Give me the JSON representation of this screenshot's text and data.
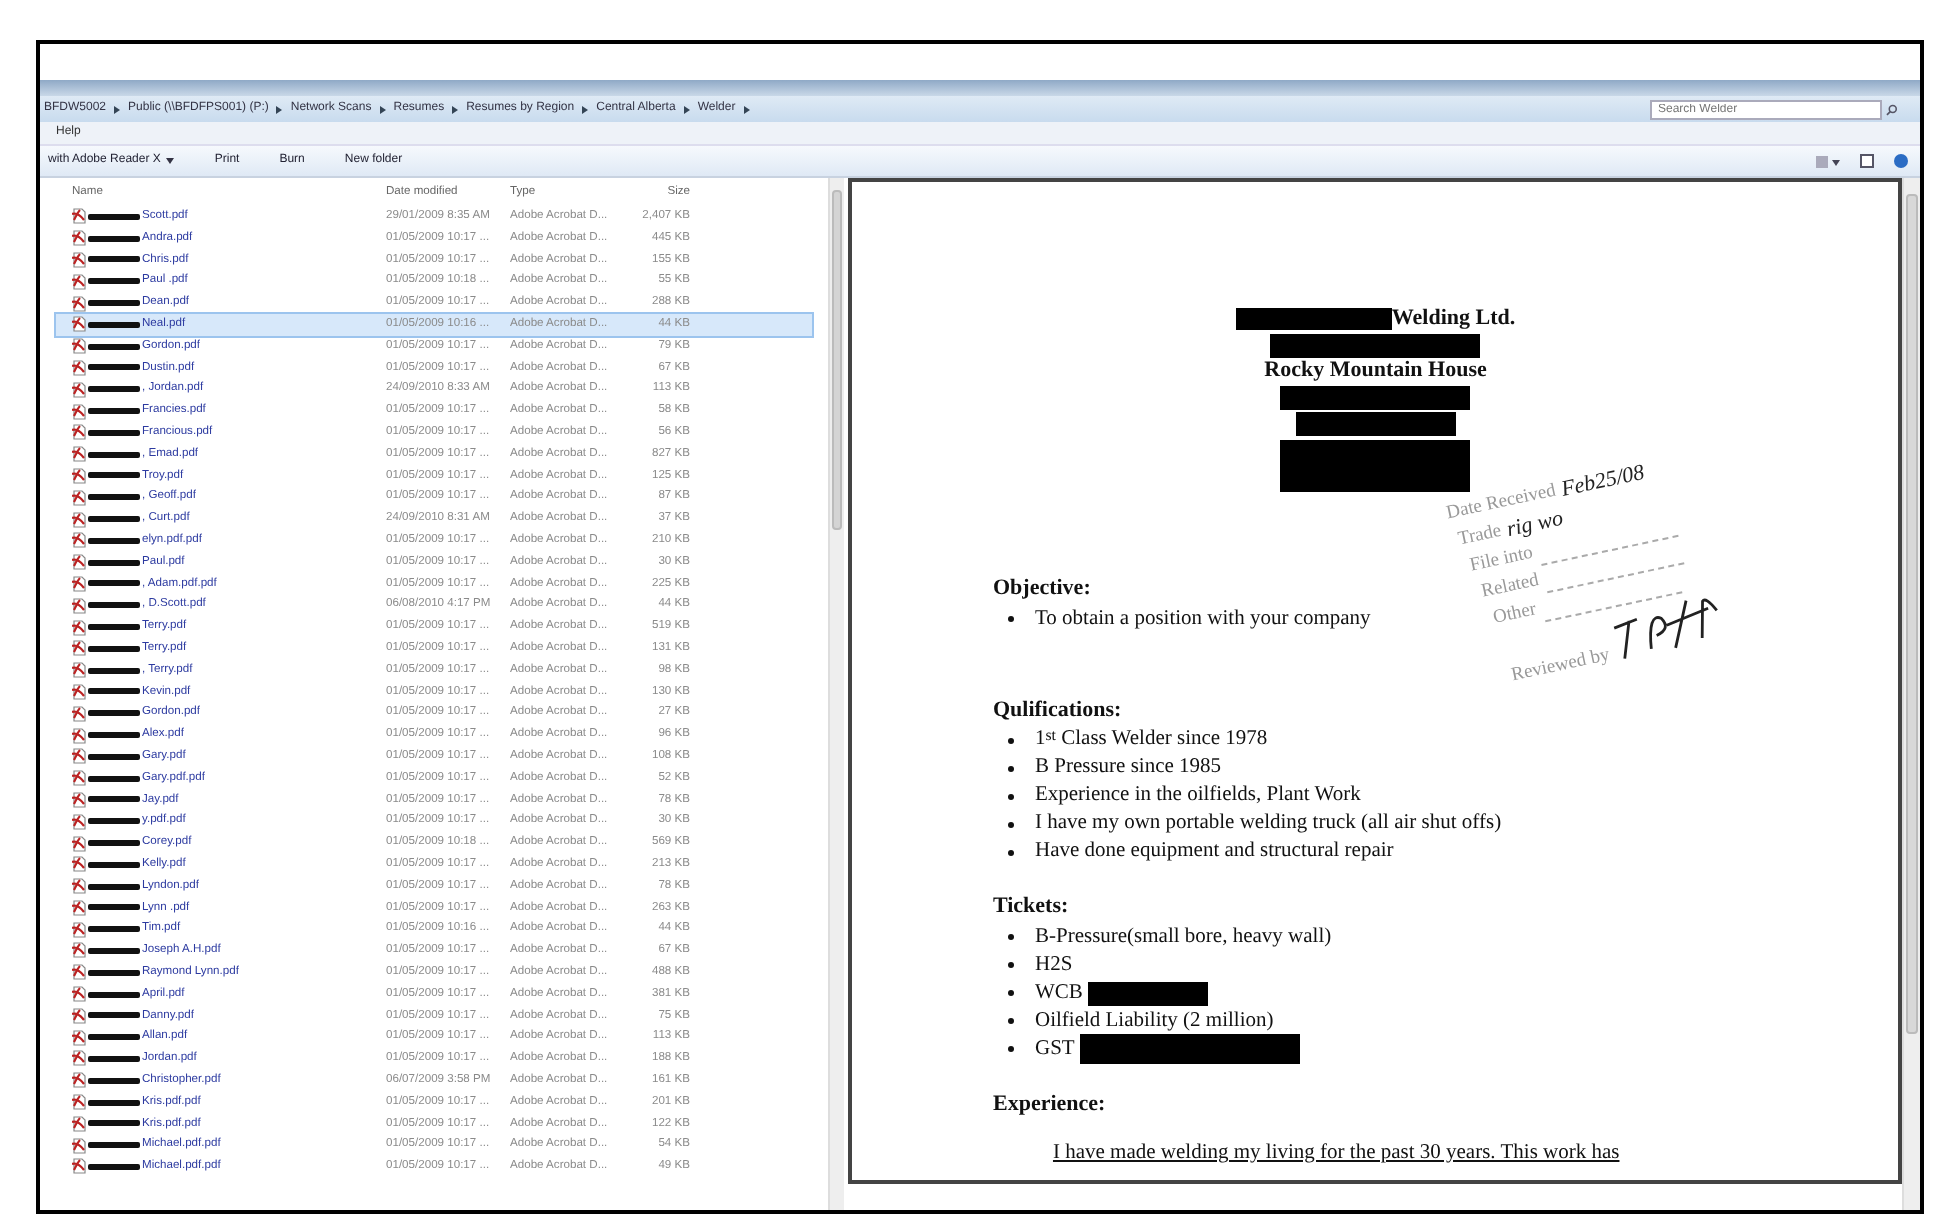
{
  "address": {
    "crumbs": [
      "BFDW5002",
      "Public (\\\\BFDFPS001) (P:)",
      "Network Scans",
      "Resumes",
      "Resumes by Region",
      "Central Alberta",
      "Welder"
    ]
  },
  "search": {
    "placeholder": "Search Welder"
  },
  "menu": [
    "Help"
  ],
  "toolbar": [
    {
      "label": "with Adobe Reader X",
      "dropdown": true
    },
    {
      "label": "Print",
      "dropdown": false
    },
    {
      "label": "Burn",
      "dropdown": false
    },
    {
      "label": "New folder",
      "dropdown": false
    }
  ],
  "columns": [
    "Name",
    "Date modified",
    "Type",
    "Size"
  ],
  "files": [
    {
      "name": "Scott.pdf",
      "date": "29/01/2009 8:35 AM",
      "type": "Adobe Acrobat D...",
      "size": "2,407 KB",
      "redacted": true,
      "selected": false
    },
    {
      "name": "Andra.pdf",
      "date": "01/05/2009 10:17 ...",
      "type": "Adobe Acrobat D...",
      "size": "445 KB",
      "redacted": true,
      "selected": false
    },
    {
      "name": "Chris.pdf",
      "date": "01/05/2009 10:17 ...",
      "type": "Adobe Acrobat D...",
      "size": "155 KB",
      "redacted": true,
      "selected": false
    },
    {
      "name": "Paul .pdf",
      "date": "01/05/2009 10:18 ...",
      "type": "Adobe Acrobat D...",
      "size": "55 KB",
      "redacted": true,
      "selected": false
    },
    {
      "name": "Dean.pdf",
      "date": "01/05/2009 10:17 ...",
      "type": "Adobe Acrobat D...",
      "size": "288 KB",
      "redacted": true,
      "selected": false
    },
    {
      "name": "Neal.pdf",
      "date": "01/05/2009 10:16 ...",
      "type": "Adobe Acrobat D...",
      "size": "44 KB",
      "redacted": true,
      "selected": true
    },
    {
      "name": "Gordon.pdf",
      "date": "01/05/2009 10:17 ...",
      "type": "Adobe Acrobat D...",
      "size": "79 KB",
      "redacted": true,
      "selected": false
    },
    {
      "name": "Dustin.pdf",
      "date": "01/05/2009 10:17 ...",
      "type": "Adobe Acrobat D...",
      "size": "67 KB",
      "redacted": true,
      "selected": false
    },
    {
      "name": ", Jordan.pdf",
      "date": "24/09/2010 8:33 AM",
      "type": "Adobe Acrobat D...",
      "size": "113 KB",
      "redacted": true,
      "selected": false
    },
    {
      "name": "Francies.pdf",
      "date": "01/05/2009 10:17 ...",
      "type": "Adobe Acrobat D...",
      "size": "58 KB",
      "redacted": true,
      "selected": false
    },
    {
      "name": "Francious.pdf",
      "date": "01/05/2009 10:17 ...",
      "type": "Adobe Acrobat D...",
      "size": "56 KB",
      "redacted": true,
      "selected": false
    },
    {
      "name": ", Emad.pdf",
      "date": "01/05/2009 10:17 ...",
      "type": "Adobe Acrobat D...",
      "size": "827 KB",
      "redacted": true,
      "selected": false
    },
    {
      "name": "Troy.pdf",
      "date": "01/05/2009 10:17 ...",
      "type": "Adobe Acrobat D...",
      "size": "125 KB",
      "redacted": true,
      "selected": false
    },
    {
      "name": ", Geoff.pdf",
      "date": "01/05/2009 10:17 ...",
      "type": "Adobe Acrobat D...",
      "size": "87 KB",
      "redacted": true,
      "selected": false
    },
    {
      "name": ", Curt.pdf",
      "date": "24/09/2010 8:31 AM",
      "type": "Adobe Acrobat D...",
      "size": "37 KB",
      "redacted": true,
      "selected": false
    },
    {
      "name": "elyn.pdf.pdf",
      "date": "01/05/2009 10:17 ...",
      "type": "Adobe Acrobat D...",
      "size": "210 KB",
      "redacted": true,
      "selected": false
    },
    {
      "name": "Paul.pdf",
      "date": "01/05/2009 10:17 ...",
      "type": "Adobe Acrobat D...",
      "size": "30 KB",
      "redacted": true,
      "selected": false
    },
    {
      "name": ", Adam.pdf.pdf",
      "date": "01/05/2009 10:17 ...",
      "type": "Adobe Acrobat D...",
      "size": "225 KB",
      "redacted": true,
      "selected": false
    },
    {
      "name": ", D.Scott.pdf",
      "date": "06/08/2010 4:17 PM",
      "type": "Adobe Acrobat D...",
      "size": "44 KB",
      "redacted": true,
      "selected": false
    },
    {
      "name": "Terry.pdf",
      "date": "01/05/2009 10:17 ...",
      "type": "Adobe Acrobat D...",
      "size": "519 KB",
      "redacted": true,
      "selected": false
    },
    {
      "name": "Terry.pdf",
      "date": "01/05/2009 10:17 ...",
      "type": "Adobe Acrobat D...",
      "size": "131 KB",
      "redacted": true,
      "selected": false
    },
    {
      "name": ", Terry.pdf",
      "date": "01/05/2009 10:17 ...",
      "type": "Adobe Acrobat D...",
      "size": "98 KB",
      "redacted": true,
      "selected": false
    },
    {
      "name": "Kevin.pdf",
      "date": "01/05/2009 10:17 ...",
      "type": "Adobe Acrobat D...",
      "size": "130 KB",
      "redacted": true,
      "selected": false
    },
    {
      "name": "Gordon.pdf",
      "date": "01/05/2009 10:17 ...",
      "type": "Adobe Acrobat D...",
      "size": "27 KB",
      "redacted": true,
      "selected": false
    },
    {
      "name": "Alex.pdf",
      "date": "01/05/2009 10:17 ...",
      "type": "Adobe Acrobat D...",
      "size": "96 KB",
      "redacted": true,
      "selected": false
    },
    {
      "name": "Gary.pdf",
      "date": "01/05/2009 10:17 ...",
      "type": "Adobe Acrobat D...",
      "size": "108 KB",
      "redacted": true,
      "selected": false
    },
    {
      "name": "Gary.pdf.pdf",
      "date": "01/05/2009 10:17 ...",
      "type": "Adobe Acrobat D...",
      "size": "52 KB",
      "redacted": true,
      "selected": false
    },
    {
      "name": "Jay.pdf",
      "date": "01/05/2009 10:17 ...",
      "type": "Adobe Acrobat D...",
      "size": "78 KB",
      "redacted": true,
      "selected": false
    },
    {
      "name": "y.pdf.pdf",
      "date": "01/05/2009 10:17 ...",
      "type": "Adobe Acrobat D...",
      "size": "30 KB",
      "redacted": true,
      "selected": false
    },
    {
      "name": "Corey.pdf",
      "date": "01/05/2009 10:18 ...",
      "type": "Adobe Acrobat D...",
      "size": "569 KB",
      "redacted": true,
      "selected": false
    },
    {
      "name": "Kelly.pdf",
      "date": "01/05/2009 10:17 ...",
      "type": "Adobe Acrobat D...",
      "size": "213 KB",
      "redacted": true,
      "selected": false
    },
    {
      "name": "Lyndon.pdf",
      "date": "01/05/2009 10:17 ...",
      "type": "Adobe Acrobat D...",
      "size": "78 KB",
      "redacted": true,
      "selected": false
    },
    {
      "name": "Lynn .pdf",
      "date": "01/05/2009 10:17 ...",
      "type": "Adobe Acrobat D...",
      "size": "263 KB",
      "redacted": true,
      "selected": false
    },
    {
      "name": "Tim.pdf",
      "date": "01/05/2009 10:16 ...",
      "type": "Adobe Acrobat D...",
      "size": "44 KB",
      "redacted": true,
      "selected": false
    },
    {
      "name": "Joseph A.H.pdf",
      "date": "01/05/2009 10:17 ...",
      "type": "Adobe Acrobat D...",
      "size": "67 KB",
      "redacted": true,
      "selected": false
    },
    {
      "name": "Raymond Lynn.pdf",
      "date": "01/05/2009 10:17 ...",
      "type": "Adobe Acrobat D...",
      "size": "488 KB",
      "redacted": true,
      "selected": false
    },
    {
      "name": "April.pdf",
      "date": "01/05/2009 10:17 ...",
      "type": "Adobe Acrobat D...",
      "size": "381 KB",
      "redacted": true,
      "selected": false
    },
    {
      "name": "Danny.pdf",
      "date": "01/05/2009 10:17 ...",
      "type": "Adobe Acrobat D...",
      "size": "75 KB",
      "redacted": true,
      "selected": false
    },
    {
      "name": "Allan.pdf",
      "date": "01/05/2009 10:17 ...",
      "type": "Adobe Acrobat D...",
      "size": "113 KB",
      "redacted": true,
      "selected": false
    },
    {
      "name": "Jordan.pdf",
      "date": "01/05/2009 10:17 ...",
      "type": "Adobe Acrobat D...",
      "size": "188 KB",
      "redacted": true,
      "selected": false
    },
    {
      "name": "Christopher.pdf",
      "date": "06/07/2009 3:58 PM",
      "type": "Adobe Acrobat D...",
      "size": "161 KB",
      "redacted": true,
      "selected": false
    },
    {
      "name": "Kris.pdf.pdf",
      "date": "01/05/2009 10:17 ...",
      "type": "Adobe Acrobat D...",
      "size": "201 KB",
      "redacted": true,
      "selected": false
    },
    {
      "name": "Kris.pdf.pdf",
      "date": "01/05/2009 10:17 ...",
      "type": "Adobe Acrobat D...",
      "size": "122 KB",
      "redacted": true,
      "selected": false
    },
    {
      "name": "Michael.pdf.pdf",
      "date": "01/05/2009 10:17 ...",
      "type": "Adobe Acrobat D...",
      "size": "54 KB",
      "redacted": true,
      "selected": false
    },
    {
      "name": "Michael.pdf.pdf",
      "date": "01/05/2009 10:17 ...",
      "type": "Adobe Acrobat D...",
      "size": "49 KB",
      "redacted": true,
      "selected": false
    }
  ],
  "document": {
    "header": [
      {
        "kind": "redacted-text",
        "text": "Welding Ltd."
      },
      {
        "kind": "redaction"
      },
      {
        "kind": "text",
        "text": "Rocky Mountain House"
      },
      {
        "kind": "redaction"
      },
      {
        "kind": "redaction"
      },
      {
        "kind": "redaction-block"
      }
    ],
    "stamp": {
      "fields": [
        {
          "label": "Date Received",
          "entry": "Feb25/08"
        },
        {
          "label": "Trade",
          "entry": "rig wo"
        },
        {
          "label": "File into"
        },
        {
          "label": "Related"
        },
        {
          "label": "Other"
        },
        {
          "label": "Reviewed by",
          "signed": true
        }
      ]
    },
    "sections": [
      {
        "heading": "Objective:",
        "items": [
          {
            "text": "To obtain a position with your company"
          }
        ]
      },
      {
        "heading": "Qulifications:",
        "items": [
          {
            "text": "1$^{st}$ Class Welder since 1978"
          },
          {
            "text": "B Pressure since 1985"
          },
          {
            "text": "Experience in the oilfields, Plant Work"
          },
          {
            "text": "I have my own portable welding truck (all air shut offs)"
          },
          {
            "text": "Have done equipment and structural repair"
          }
        ]
      },
      {
        "heading": "Tickets:",
        "items": [
          {
            "text": "B-Pressure(small bore, heavy wall)"
          },
          {
            "text": "H2S"
          },
          {
            "text": "WCB",
            "redaction": true
          },
          {
            "text": "Oilfield Liability (2 million)"
          },
          {
            "text": "GST",
            "redaction": true
          }
        ]
      },
      {
        "heading": "Experience:",
        "paragraph": "I have made welding my living for the past 30 years. This work has"
      }
    ]
  }
}
